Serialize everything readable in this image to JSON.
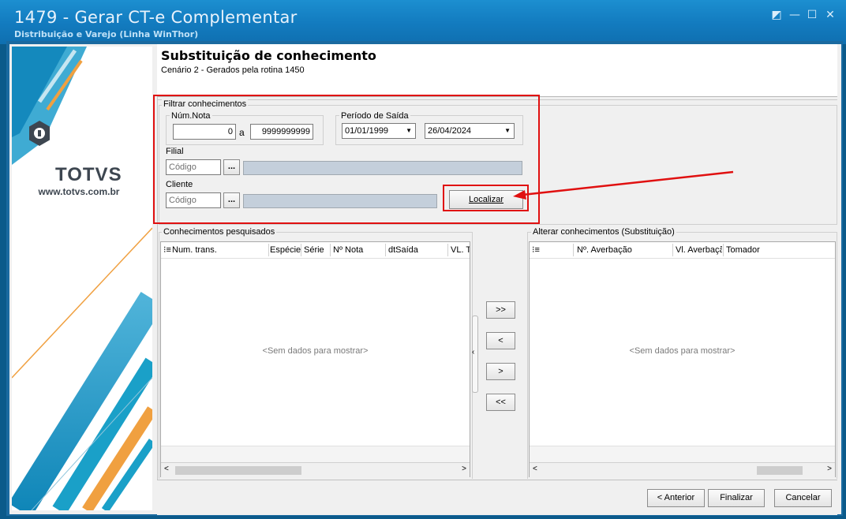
{
  "window": {
    "title": "1479 - Gerar CT-e Complementar",
    "subtitle": "Distribuição e Varejo (Linha WinThor)",
    "controls": {
      "restore": "◩",
      "minimize": "—",
      "maximize": "☐",
      "close": "✕"
    }
  },
  "sidebar": {
    "brand": "TOTVS",
    "website": "www.totvs.com.br"
  },
  "header": {
    "title": "Substituição de conhecimento",
    "subtitle": "Cenário 2 - Gerados pela rotina 1450"
  },
  "filter": {
    "group_label": "Filtrar conhecimentos",
    "num_nota": {
      "label": "Núm.Nota",
      "from": "0",
      "separator": "a",
      "to": "9999999999"
    },
    "periodo": {
      "label": "Período de Saída",
      "from": "01/01/1999",
      "to": "26/04/2024"
    },
    "filial": {
      "label": "Filial",
      "placeholder": "Código",
      "lookup": "..."
    },
    "cliente": {
      "label": "Cliente",
      "placeholder": "Código",
      "lookup": "..."
    },
    "search_button": "Localizar"
  },
  "left_grid": {
    "group_label": "Conhecimentos pesquisados",
    "columns": [
      "Num. trans.",
      "Espécie",
      "Série",
      "Nº Nota",
      "dtSaída",
      "VL. T"
    ],
    "empty_text": "<Sem dados para mostrar>"
  },
  "transfer": {
    "add_all": ">>",
    "remove": "<",
    "add": ">",
    "remove_all": "<<"
  },
  "right_grid": {
    "group_label": "Alterar conhecimentos (Substituição)",
    "columns": [
      "Nº. Averbação",
      "Vl. Averbaçã",
      "Tomador"
    ],
    "empty_text": "<Sem dados para mostrar>"
  },
  "footer": {
    "back": "< Anterior",
    "finish": "Finalizar",
    "cancel": "Cancelar"
  },
  "colors": {
    "titlebar": "#137cc0",
    "highlight": "#e01010",
    "brand_teal": "#1aa0c8",
    "brand_orange": "#f0a040"
  }
}
